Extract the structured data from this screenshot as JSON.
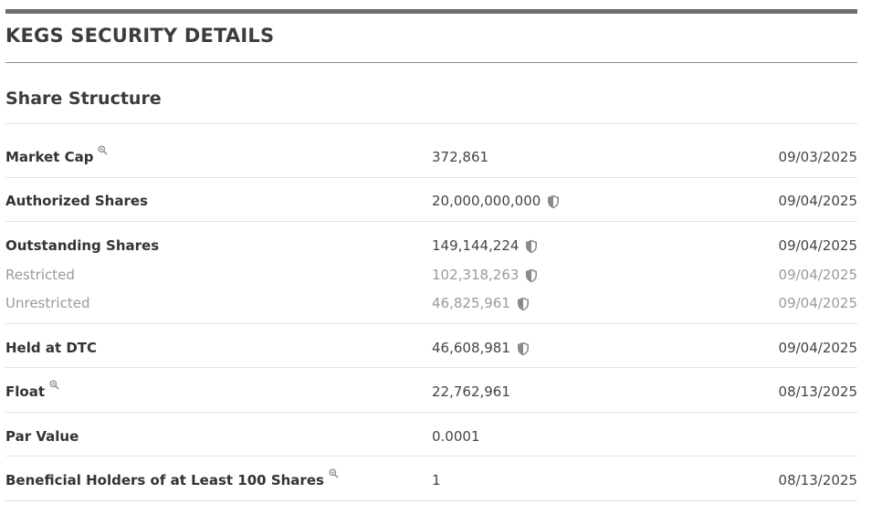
{
  "page": {
    "title": "KEGS SECURITY DETAILS"
  },
  "section": {
    "title": "Share Structure"
  },
  "rows": [
    {
      "label": "Market Cap",
      "value": "372,861",
      "date": "09/03/2025",
      "magnifier_icon": true,
      "shield_icon": false,
      "sub": false
    },
    {
      "label": "Authorized Shares",
      "value": "20,000,000,000",
      "date": "09/04/2025",
      "magnifier_icon": false,
      "shield_icon": true,
      "sub": false
    },
    {
      "label": "Outstanding Shares",
      "value": "149,144,224",
      "date": "09/04/2025",
      "magnifier_icon": false,
      "shield_icon": true,
      "sub": false
    },
    {
      "label": "Restricted",
      "value": "102,318,263",
      "date": "09/04/2025",
      "magnifier_icon": false,
      "shield_icon": true,
      "sub": true
    },
    {
      "label": "Unrestricted",
      "value": "46,825,961",
      "date": "09/04/2025",
      "magnifier_icon": false,
      "shield_icon": true,
      "sub": true
    },
    {
      "label": "Held at DTC",
      "value": "46,608,981",
      "date": "09/04/2025",
      "magnifier_icon": false,
      "shield_icon": true,
      "sub": false
    },
    {
      "label": "Float",
      "value": "22,762,961",
      "date": "08/13/2025",
      "magnifier_icon": true,
      "shield_icon": false,
      "sub": false
    },
    {
      "label": "Par Value",
      "value": "0.0001",
      "date": "",
      "magnifier_icon": false,
      "shield_icon": false,
      "sub": false
    },
    {
      "label": "Beneficial Holders of at Least 100 Shares",
      "value": "1",
      "date": "08/13/2025",
      "magnifier_icon": true,
      "shield_icon": false,
      "sub": false
    }
  ],
  "icons": {
    "shield": "shield-icon",
    "magnifier": "magnifier-icon"
  },
  "colors": {
    "top_bar": "#6e6e6e",
    "label": "#333333",
    "muted": "#9a9a9a",
    "shield": "#8a8a8a",
    "divider": "#e2e2e2"
  }
}
